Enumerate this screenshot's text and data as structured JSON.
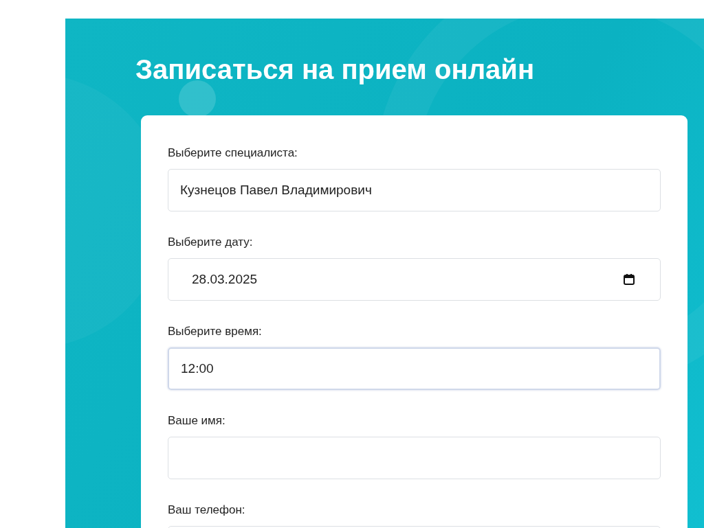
{
  "title": "Записаться на прием онлайн",
  "fields": [
    {
      "kind": "select",
      "label": "Выберите специалиста:",
      "value": "Кузнецов Павел Владимирович",
      "focused": false
    },
    {
      "kind": "date",
      "label": "Выберите дату:",
      "value": "28.03.2025",
      "focused": false
    },
    {
      "kind": "time",
      "label": "Выберите время:",
      "value": "12:00",
      "focused": true
    },
    {
      "kind": "text",
      "label": "Ваше имя:",
      "focused": false
    },
    {
      "kind": "tel",
      "label": "Ваш телефон:",
      "focused": false
    }
  ]
}
